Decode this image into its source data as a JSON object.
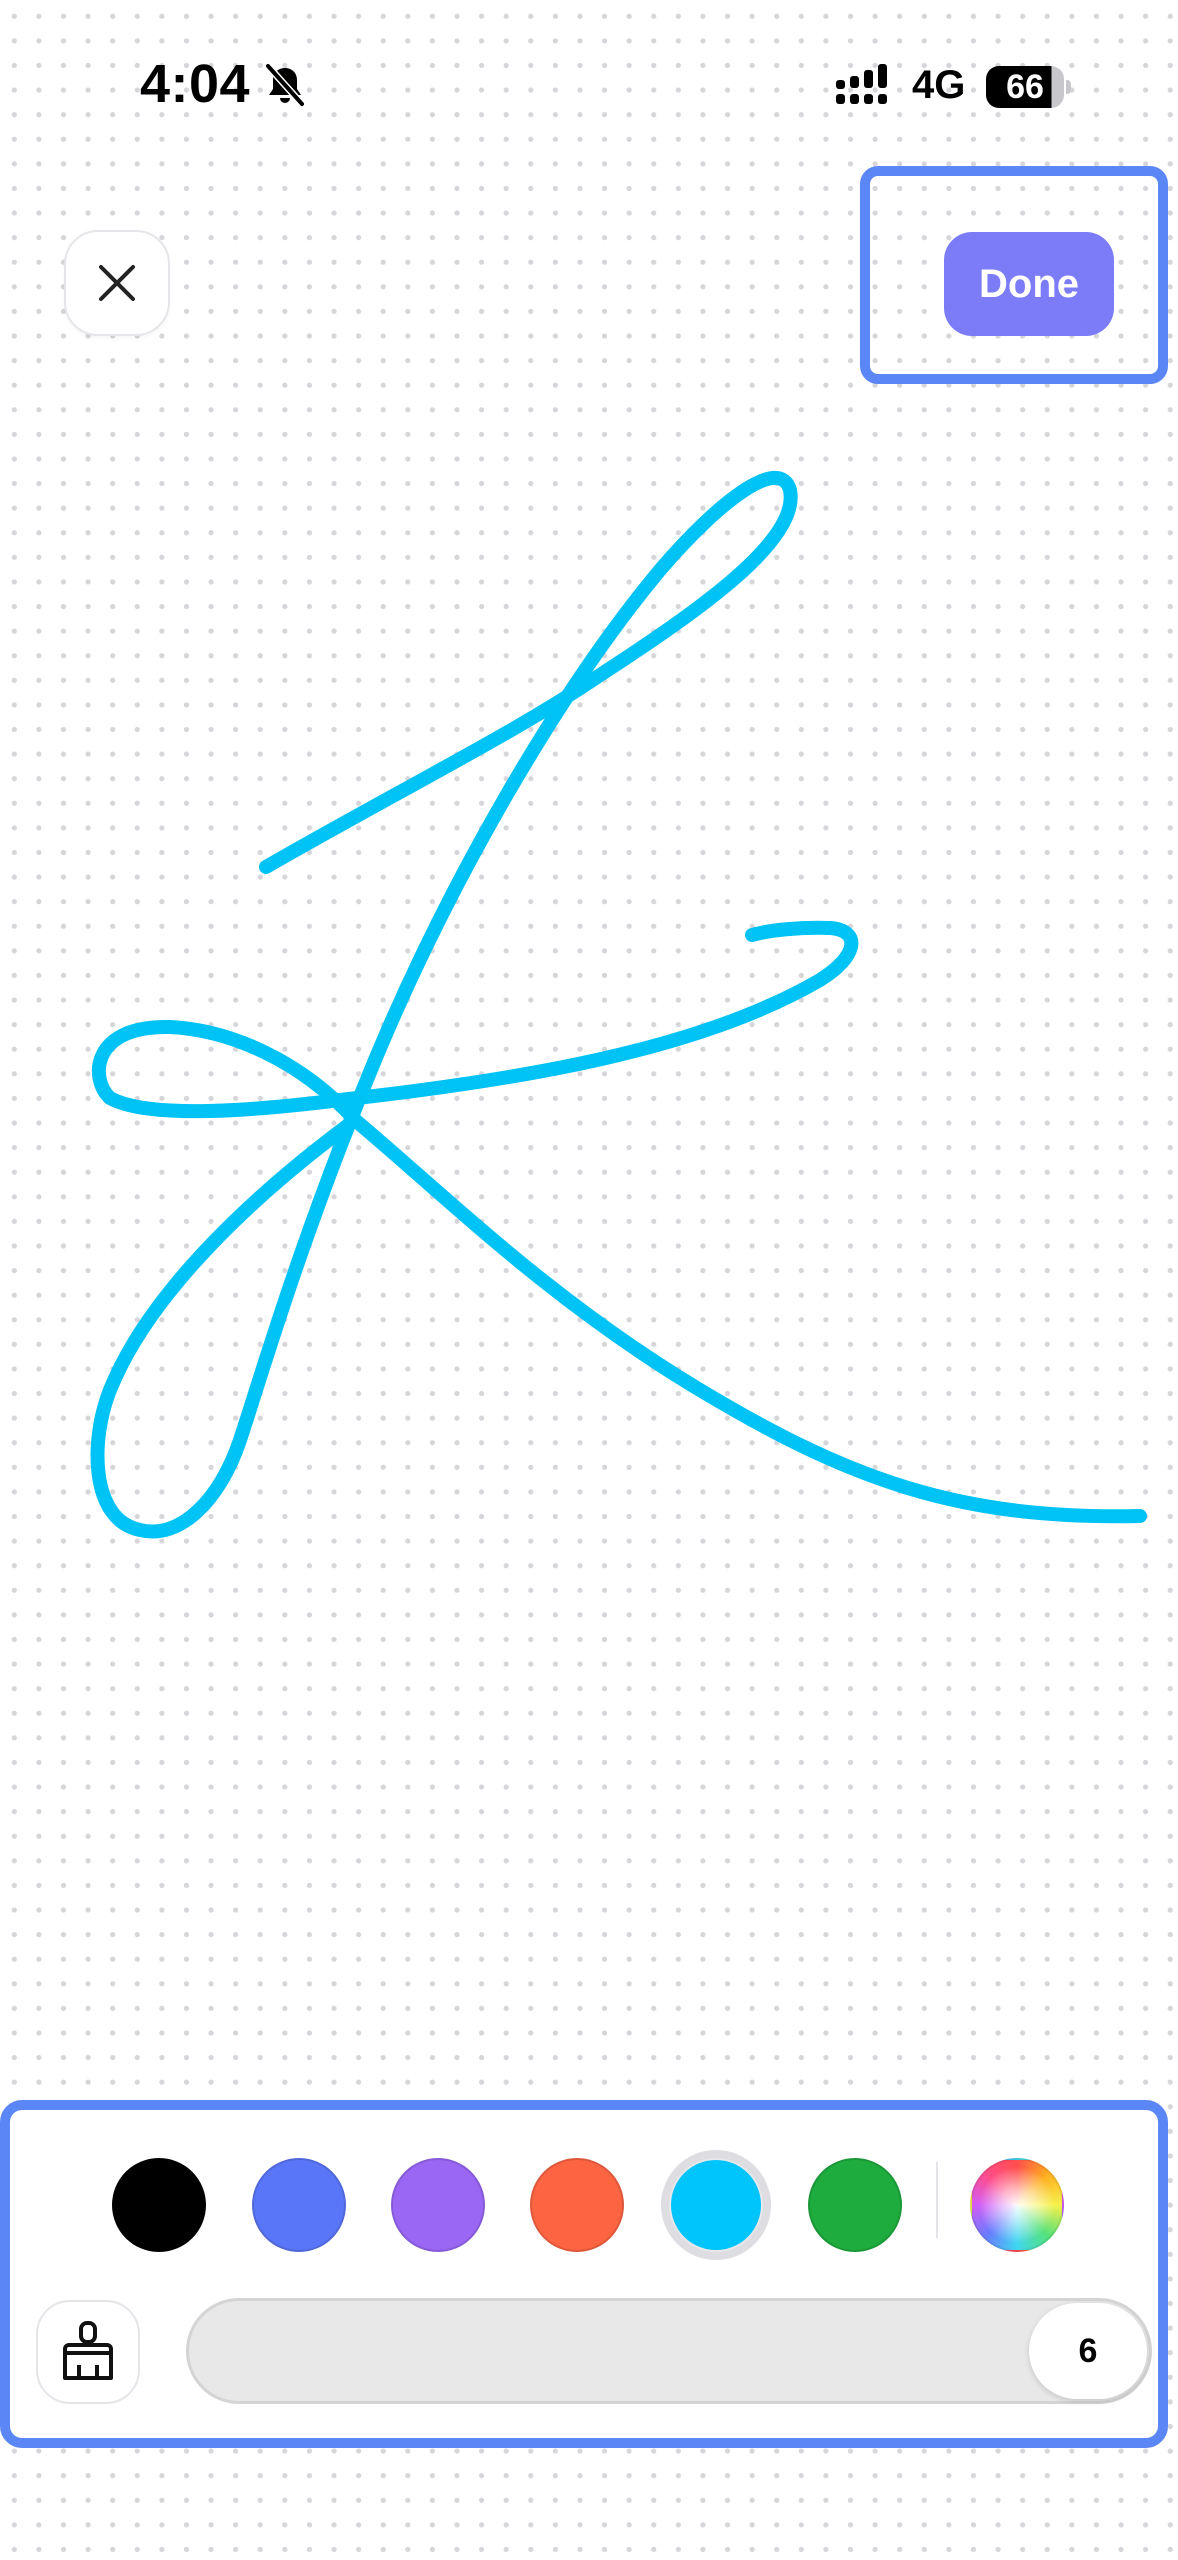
{
  "status_bar": {
    "time": "4:04",
    "network": "4G",
    "battery": "66",
    "icons": [
      "bell-slash-icon",
      "signal-icon",
      "battery-icon"
    ]
  },
  "header": {
    "close_icon": "close-icon",
    "done_label": "Done",
    "done_color": "#7c7cf9"
  },
  "canvas": {
    "stroke_color": "#00c3f5",
    "strokes": 1
  },
  "toolbar": {
    "colors": [
      {
        "name": "black",
        "hex": "#000000"
      },
      {
        "name": "blue",
        "hex": "#5a76f8"
      },
      {
        "name": "purple",
        "hex": "#9967f4"
      },
      {
        "name": "orange",
        "hex": "#fd6442"
      },
      {
        "name": "cyan",
        "hex": "#00c4fc"
      },
      {
        "name": "green",
        "hex": "#1eac3e"
      }
    ],
    "selected_color": "cyan",
    "custom_color_icon": "color-wheel-icon",
    "eraser_icon": "brush-icon",
    "brush_size": "6"
  },
  "highlight_color": "#5b86f5"
}
